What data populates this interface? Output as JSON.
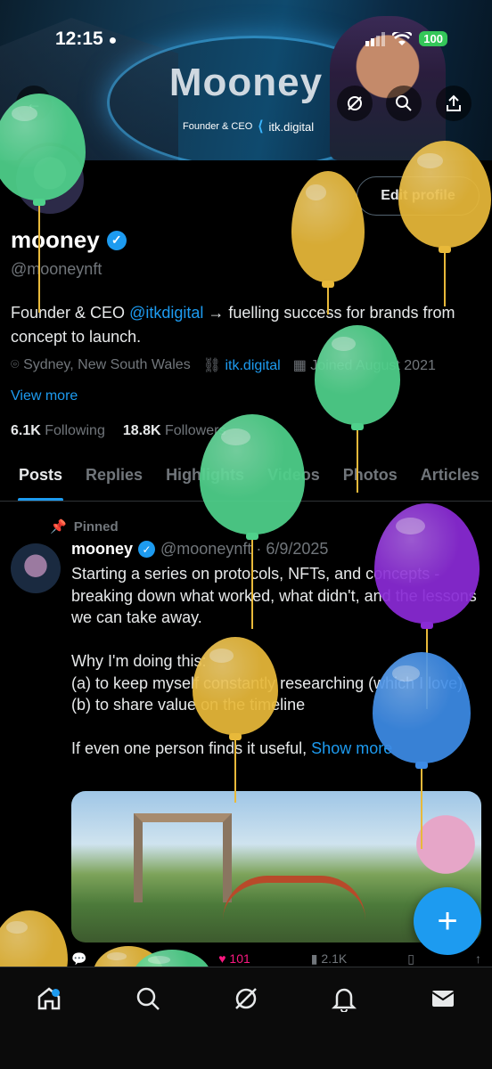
{
  "status": {
    "time": "12:15",
    "battery": "100"
  },
  "banner": {
    "title": "Mooney",
    "subtitle_role": "Founder & CEO",
    "subtitle_brand": "itk.digital"
  },
  "profile": {
    "edit_label": "Edit profile",
    "name": "mooney",
    "handle": "@mooneynft",
    "bio_prefix": "Founder & CEO ",
    "bio_mention": "@itkdigital",
    "bio_suffix": " → fuelling success for brands from concept to launch.",
    "location": "Sydney, New South Wales",
    "website": "itk.digital",
    "joined": "Joined August 2021",
    "view_more": "View more",
    "following_count": "6.1K",
    "following_label": "Following",
    "followers_count": "18.8K",
    "followers_label": "Followers"
  },
  "tabs": [
    "Posts",
    "Replies",
    "Highlights",
    "Videos",
    "Photos",
    "Articles"
  ],
  "post": {
    "pinned_label": "Pinned",
    "author": "mooney",
    "handle_date": "@mooneynft · 6/9/2025",
    "body": "Starting a series on protocols, NFTs, and concepts - breaking down what worked, what didn't, and the lessons we can take away.\n\nWhy I'm doing this:\n(a) to keep myself constantly researching (which I love)\n(b) to share value on the timeline\n\nIf even one person finds it useful, ",
    "show_more": "Show more",
    "likes": "101",
    "views": "2.1K"
  },
  "colors": {
    "accent": "#1d9bf0",
    "like": "#f91880",
    "balloon_green": "#4fd18b",
    "balloon_yellow": "#e8b93a",
    "balloon_purple": "#8a2bd6",
    "balloon_blue": "#3d8be6"
  },
  "icons": {
    "header": [
      "grok-icon",
      "search-icon",
      "share-icon"
    ],
    "nav": [
      "home-icon",
      "search-icon",
      "grok-icon",
      "bell-icon",
      "mail-icon"
    ]
  }
}
